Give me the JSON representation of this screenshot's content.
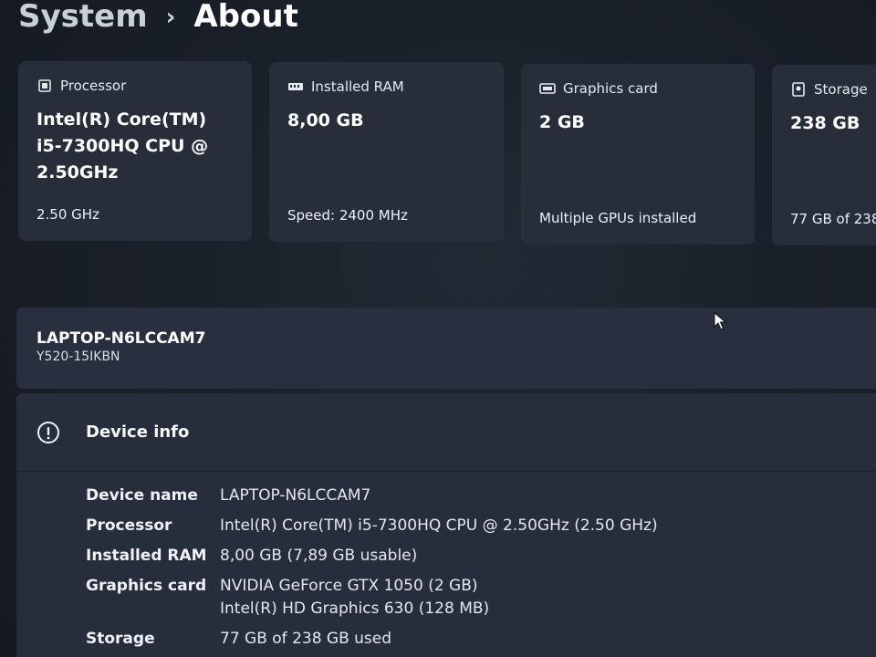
{
  "breadcrumb": {
    "parent": "System",
    "separator": "›",
    "current": "About"
  },
  "spec_cards": [
    {
      "icon": "processor-icon",
      "title": "Processor",
      "value": "Intel(R) Core(TM) i5-7300HQ CPU @ 2.50GHz",
      "sub": "2.50 GHz"
    },
    {
      "icon": "ram-icon",
      "title": "Installed RAM",
      "value": "8,00 GB",
      "sub": "Speed: 2400 MHz"
    },
    {
      "icon": "graphics-card-icon",
      "title": "Graphics card",
      "value": "2 GB",
      "sub": "Multiple GPUs installed"
    },
    {
      "icon": "storage-icon",
      "title": "Storage",
      "value": "238 GB",
      "sub": "77 GB of 238"
    }
  ],
  "device_banner": {
    "name": "LAPTOP-N6LCCAM7",
    "model": "Y520-15IKBN"
  },
  "device_info": {
    "title": "Device info",
    "rows": [
      {
        "label": "Device name",
        "value": "LAPTOP-N6LCCAM7"
      },
      {
        "label": "Processor",
        "value": "Intel(R) Core(TM) i5-7300HQ CPU @ 2.50GHz (2.50 GHz)"
      },
      {
        "label": "Installed RAM",
        "value": "8,00 GB (7,89 GB usable)"
      },
      {
        "label": "Graphics card",
        "value": "NVIDIA GeForce GTX 1050 (2 GB)",
        "value2": "Intel(R) HD Graphics 630 (128 MB)"
      },
      {
        "label": "Storage",
        "value": "77 GB of 238 GB used"
      }
    ]
  }
}
